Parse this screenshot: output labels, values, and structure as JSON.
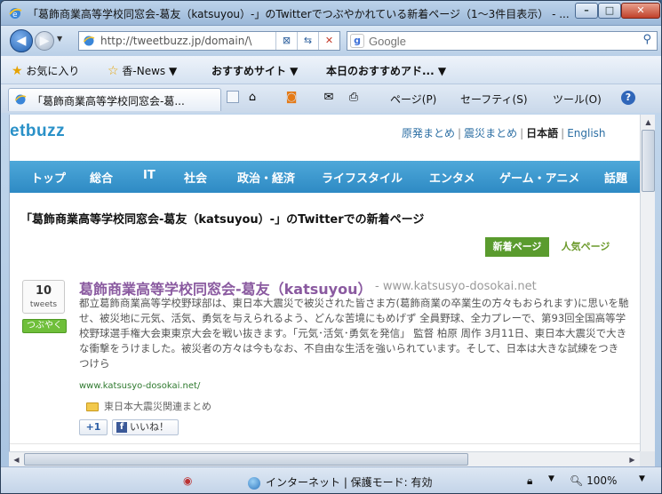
{
  "window": {
    "title": "「葛飾商業高等学校同窓会-葛友（katsuyou）-」のTwitterでつぶやかれている新着ページ（1～3件目表示） - ...",
    "controls": {
      "minimize": "–",
      "maximize": "□",
      "close": "✕"
    }
  },
  "nav": {
    "back_glyph": "◀",
    "forward_glyph": "▶",
    "dropdown_glyph": "▼",
    "url": "http://tweetbuzz.jp/domain/\\",
    "addr_buttons": [
      "⊠",
      "⇆",
      "✕"
    ],
    "search_engine": "Google",
    "search_placeholder": "Google",
    "search_glyph": "⚲"
  },
  "favorites": {
    "favorites_label": "お気に入り",
    "items": [
      "香-News ▼",
      "おすすめサイト ▼",
      "本日のおすすめアド... ▼"
    ]
  },
  "tabbar": {
    "tab_label": "「葛飾商業高等学校同窓会-葛...",
    "page_menu": "ページ(P)",
    "safety_menu": "セーフティ(S)",
    "tools_menu": "ツール(O)",
    "dropdown": "▼"
  },
  "site": {
    "logo": "etbuzz",
    "top_links": {
      "recap": "原発まとめ",
      "quake": "震災まとめ",
      "japanese": "日本語",
      "english": "English"
    },
    "categories": [
      "トップ",
      "総合",
      "IT",
      "社会",
      "政治・経済",
      "ライフスタイル",
      "エンタメ",
      "ゲーム・アニメ",
      "話題"
    ],
    "page_title": "「葛飾商業高等学校同窓会-葛友（katsuyou）-」のTwitterでの新着ページ",
    "tabs": {
      "new": "新着ページ",
      "popular": "人気ページ"
    },
    "entry": {
      "count": "10",
      "count_unit": "tweets",
      "tweet_button": "つぶやく",
      "title": "葛飾商業高等学校同窓会-葛友（katsuyou）",
      "domain": "- www.katsusyo-dosokai.net",
      "description": "都立葛飾商業高等学校野球部は、東日本大震災で被災された皆さま方(葛飾商業の卒業生の方々もおられます)に思いを馳せ、被災地に元気、活気、勇気を与えられるよう、どんな苦境にもめげず 全員野球、全力プレーで、第93回全国高等学校野球選手権大会東東京大会を戦い抜きます。「元気･活気･勇気を発信」 監督 柏原 周作 3月11日、東日本大震災で大きな衝撃をうけました。被災者の方々は今もなお、不自由な生活を強いられています。そして、日本は大きな試練をつき つけら",
      "source_url": "www.katsusyo-dosokai.net/",
      "tag": "東日本大震災関連まとめ",
      "plus_one": "+1",
      "like": "いいね！",
      "fb_letter": "f"
    }
  },
  "status": {
    "zone": "インターネット | 保護モード: 有効",
    "zoom": "100%",
    "dropdown": "▼"
  }
}
